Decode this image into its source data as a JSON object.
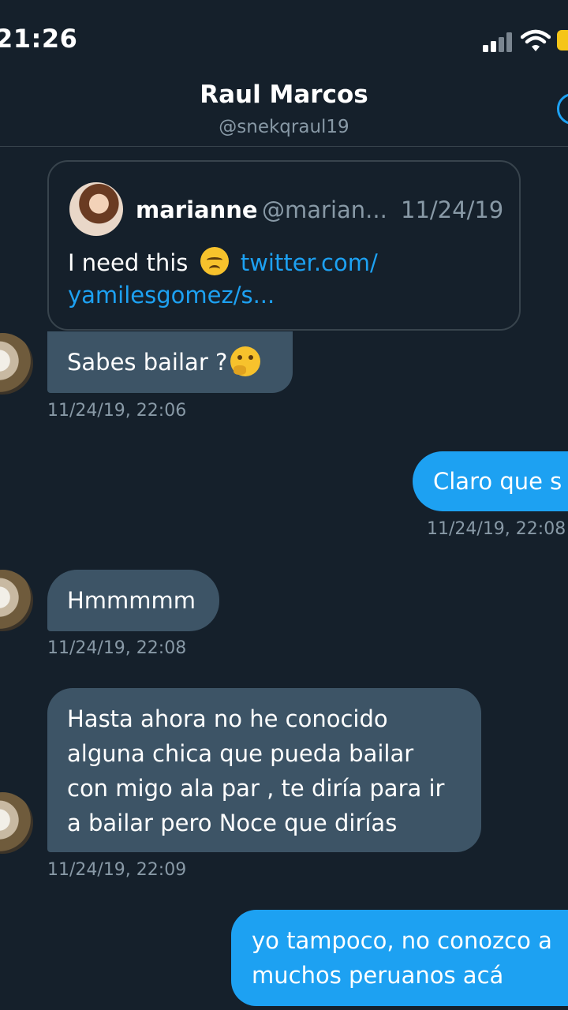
{
  "status_bar": {
    "time": "21:26",
    "battery_color": "#f5c518"
  },
  "header": {
    "name": "Raul Marcos",
    "handle": "@snekqraul19",
    "info_icon": "info-icon"
  },
  "quoted_tweet": {
    "author": "marianne",
    "handle": "@marian...",
    "date": "11/24/19",
    "text": "I need this",
    "emoji": "disappointed-face",
    "link_line1": "twitter.com/",
    "link_line2": "yamilesgomez/s..."
  },
  "messages": [
    {
      "id": "m1",
      "direction": "in",
      "text": "Sabes bailar ?",
      "emoji": "thinking-face",
      "timestamp": "11/24/19, 22:06"
    },
    {
      "id": "m2",
      "direction": "out",
      "text": "Claro que s",
      "timestamp": "11/24/19, 22:08"
    },
    {
      "id": "m3",
      "direction": "in",
      "text": "Hmmmmm",
      "timestamp": "11/24/19, 22:08"
    },
    {
      "id": "m4",
      "direction": "in",
      "lines": [
        "Hasta ahora no he conocido",
        "alguna chica que pueda bailar",
        "con migo ala par , te diría para ir",
        "a bailar pero Noce que dirías"
      ],
      "timestamp": "11/24/19, 22:09"
    },
    {
      "id": "m5",
      "direction": "out",
      "lines": [
        "yo tampoco, no conozco a",
        "muchos peruanos acá"
      ]
    }
  ],
  "colors": {
    "background": "#15202b",
    "incoming_bubble": "#3d5466",
    "outgoing_bubble": "#1da1f2",
    "link": "#1da1f2",
    "secondary_text": "#8899a6"
  }
}
